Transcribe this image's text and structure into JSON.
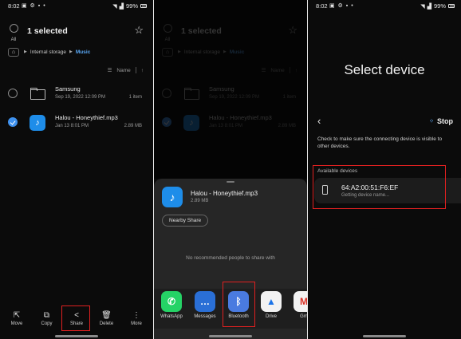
{
  "status": {
    "time": "8:02",
    "battery": "99%"
  },
  "panel1": {
    "select_all_label": "All",
    "title": "1 selected",
    "breadcrumb": [
      "Internal storage",
      "Music"
    ],
    "sort_label": "Name",
    "rows": [
      {
        "name": "Samsung",
        "date": "Sep 19, 2022 12:09 PM",
        "meta": "1 item",
        "checked": false,
        "icon": "folder-icon"
      },
      {
        "name": "Halou - Honeythief.mp3",
        "date": "Jan 13 8:01 PM",
        "meta": "2.89 MB",
        "checked": true,
        "icon": "music-file-icon"
      }
    ],
    "bottom_actions": [
      {
        "label": "Move",
        "icon": "move-icon"
      },
      {
        "label": "Copy",
        "icon": "copy-icon"
      },
      {
        "label": "Share",
        "icon": "share-icon"
      },
      {
        "label": "Delete",
        "icon": "delete-icon"
      },
      {
        "label": "More",
        "icon": "more-icon"
      }
    ]
  },
  "panel2": {
    "file_name": "Halou - Honeythief.mp3",
    "file_size": "2.89 MB",
    "nearby_share": "Nearby Share",
    "no_people": "No recommended people to share with",
    "apps": [
      {
        "label": "WhatsApp",
        "color": "#25D366"
      },
      {
        "label": "Messages",
        "color": "#2A6FD6"
      },
      {
        "label": "Bluetooth",
        "color": "#4A7BE0"
      },
      {
        "label": "Drive",
        "color": "#f2f2f2"
      },
      {
        "label": "Gm",
        "color": "#f2f2f2"
      }
    ]
  },
  "panel3": {
    "title": "Select device",
    "stop_label": "Stop",
    "hint": "Check to make sure the connecting device is visible to other devices.",
    "available_label": "Available devices",
    "device_name": "64:A2:00:51:F6:EF",
    "device_status": "Getting device name..."
  },
  "colors": {
    "accent": "#3e91ee",
    "highlight": "#e02020",
    "background": "#0b0b0b"
  }
}
